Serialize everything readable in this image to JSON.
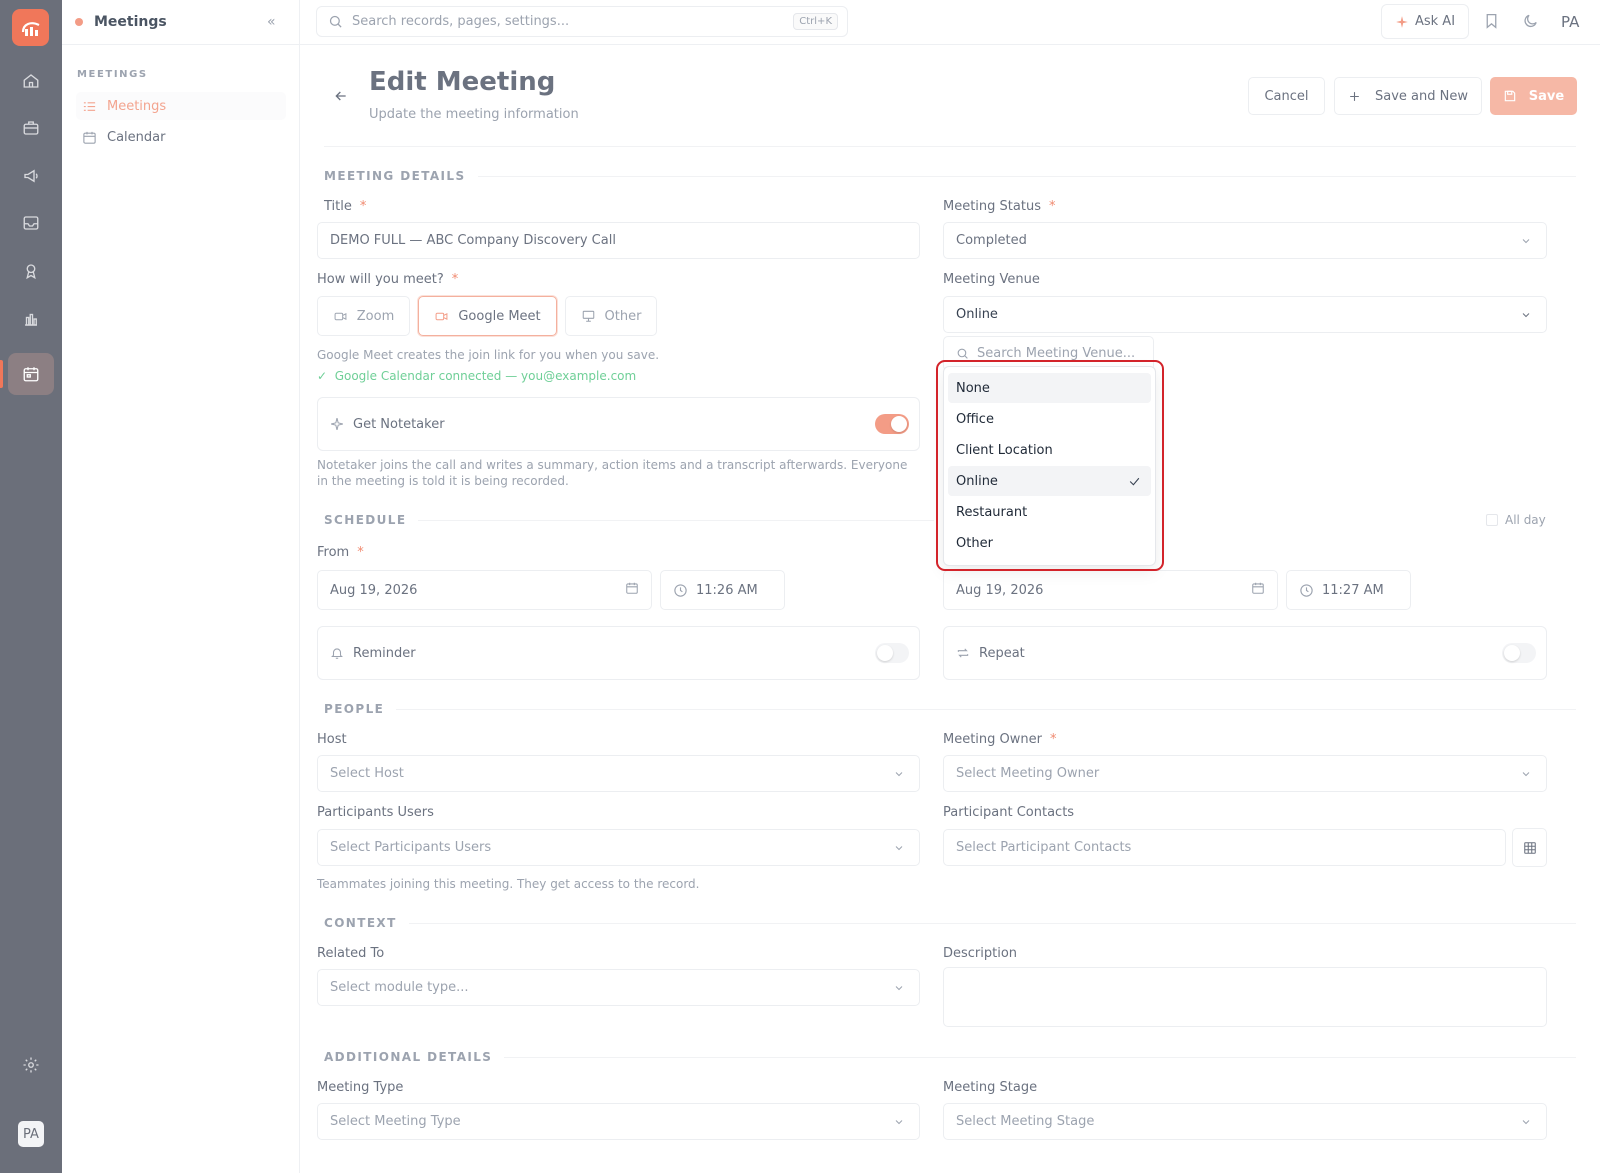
{
  "app": {
    "module_name": "Meetings",
    "user_initials": "PA"
  },
  "sidebar": {
    "section_title": "MEETINGS",
    "items": [
      {
        "label": "Meetings"
      },
      {
        "label": "Calendar"
      }
    ]
  },
  "topbar": {
    "search_placeholder": "Search records, pages, settings...",
    "search_shortcut": "Ctrl+K",
    "ask_ai_label": "Ask AI"
  },
  "header": {
    "title": "Edit Meeting",
    "subtitle": "Update the meeting information",
    "cancel_label": "Cancel",
    "save_new_label": "Save and New",
    "save_label": "Save"
  },
  "details": {
    "section_title": "MEETING DETAILS",
    "title_label": "Title",
    "title_value": "DEMO FULL — ABC Company Discovery Call",
    "status_label": "Meeting Status",
    "status_value": "Completed",
    "how_label": "How will you meet?",
    "meet_options": [
      "Zoom",
      "Google Meet",
      "Other"
    ],
    "meet_selected": "Google Meet",
    "venue_label": "Meeting Venue",
    "venue_value": "Online",
    "gmeet_note": "Google Meet creates the join link for you when you save.",
    "gcal_note": "Google Calendar connected — you@example.com",
    "notetaker_label": "Get Notetaker",
    "notetaker_on": true,
    "notetaker_note": "Notetaker joins the call and writes a summary, action items and a transcript afterwards. Everyone in the meeting is told it is being recorded."
  },
  "venue_dropdown": {
    "search_placeholder": "Search Meeting Venue...",
    "options": [
      "None",
      "Office",
      "Client Location",
      "Online",
      "Restaurant",
      "Other"
    ],
    "highlighted": "None",
    "selected": "Online"
  },
  "schedule": {
    "section_title": "SCHEDULE",
    "all_day_label": "All day",
    "from_label": "From",
    "from_date": "Aug 19, 2026",
    "from_time": "11:26 AM",
    "to_date": "Aug 19, 2026",
    "to_time": "11:27 AM",
    "reminder_label": "Reminder",
    "repeat_label": "Repeat"
  },
  "people": {
    "section_title": "PEOPLE",
    "host_label": "Host",
    "host_placeholder": "Select Host",
    "owner_label": "Meeting Owner",
    "owner_placeholder": "Select Meeting Owner",
    "participants_users_label": "Participants Users",
    "participants_users_placeholder": "Select Participants Users",
    "participant_contacts_label": "Participant Contacts",
    "participant_contacts_placeholder": "Select Participant Contacts",
    "participants_note": "Teammates joining this meeting. They get access to the record."
  },
  "context": {
    "section_title": "CONTEXT",
    "related_label": "Related To",
    "related_placeholder": "Select module type...",
    "description_label": "Description"
  },
  "additional": {
    "section_title": "ADDITIONAL DETAILS",
    "type_label": "Meeting Type",
    "type_placeholder": "Select Meeting Type",
    "stage_label": "Meeting Stage",
    "stage_placeholder": "Select Meeting Stage"
  },
  "colors": {
    "accent": "#f0775a",
    "rail": "#6b6f7a",
    "highlight": "#d3232a"
  }
}
